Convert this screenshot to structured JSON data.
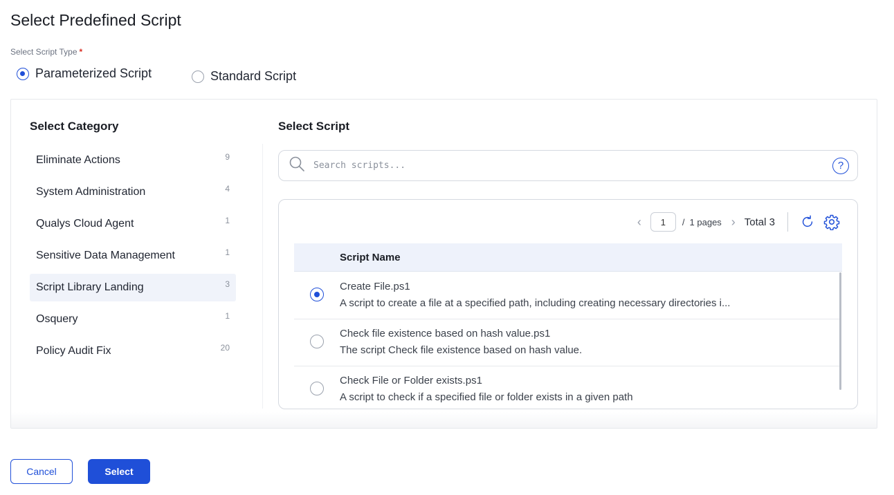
{
  "page": {
    "title": "Select Predefined Script"
  },
  "script_type": {
    "label": "Select Script Type",
    "required_mark": "*",
    "options": [
      {
        "label": "Parameterized Script",
        "selected": true
      },
      {
        "label": "Standard Script",
        "selected": false
      }
    ]
  },
  "category": {
    "title": "Select Category",
    "selected_index": 4,
    "items": [
      {
        "label": "Eliminate Actions",
        "count": "9"
      },
      {
        "label": "System Administration",
        "count": "4"
      },
      {
        "label": "Qualys Cloud Agent",
        "count": "1"
      },
      {
        "label": "Sensitive Data Management",
        "count": "1"
      },
      {
        "label": "Script Library Landing",
        "count": "3"
      },
      {
        "label": "Osquery",
        "count": "1"
      },
      {
        "label": "Policy Audit Fix",
        "count": "20"
      }
    ]
  },
  "script": {
    "title": "Select Script",
    "search_placeholder": "Search scripts...",
    "pager": {
      "current_page": "1",
      "separator": "/",
      "pages_text": "1 pages",
      "total_text": "Total 3"
    },
    "table": {
      "column_header": "Script Name",
      "rows": [
        {
          "name": "Create File.ps1",
          "description": "A script to create a file at a specified path, including creating necessary directories i...",
          "selected": true
        },
        {
          "name": "Check file existence based on hash value.ps1",
          "description": "The script Check file existence based on hash value.",
          "selected": false
        },
        {
          "name": "Check File or Folder exists.ps1",
          "description": "A script to check if a specified file or folder exists in a given path",
          "selected": false
        }
      ]
    }
  },
  "footer": {
    "cancel_label": "Cancel",
    "select_label": "Select"
  },
  "colors": {
    "accent": "#1f4fd8",
    "active_row": "#f0f3fa",
    "header_bg": "#eef2fb"
  },
  "icons": [
    "search-icon",
    "help-icon",
    "chevron-left-icon",
    "chevron-right-icon",
    "refresh-icon",
    "gear-icon"
  ]
}
